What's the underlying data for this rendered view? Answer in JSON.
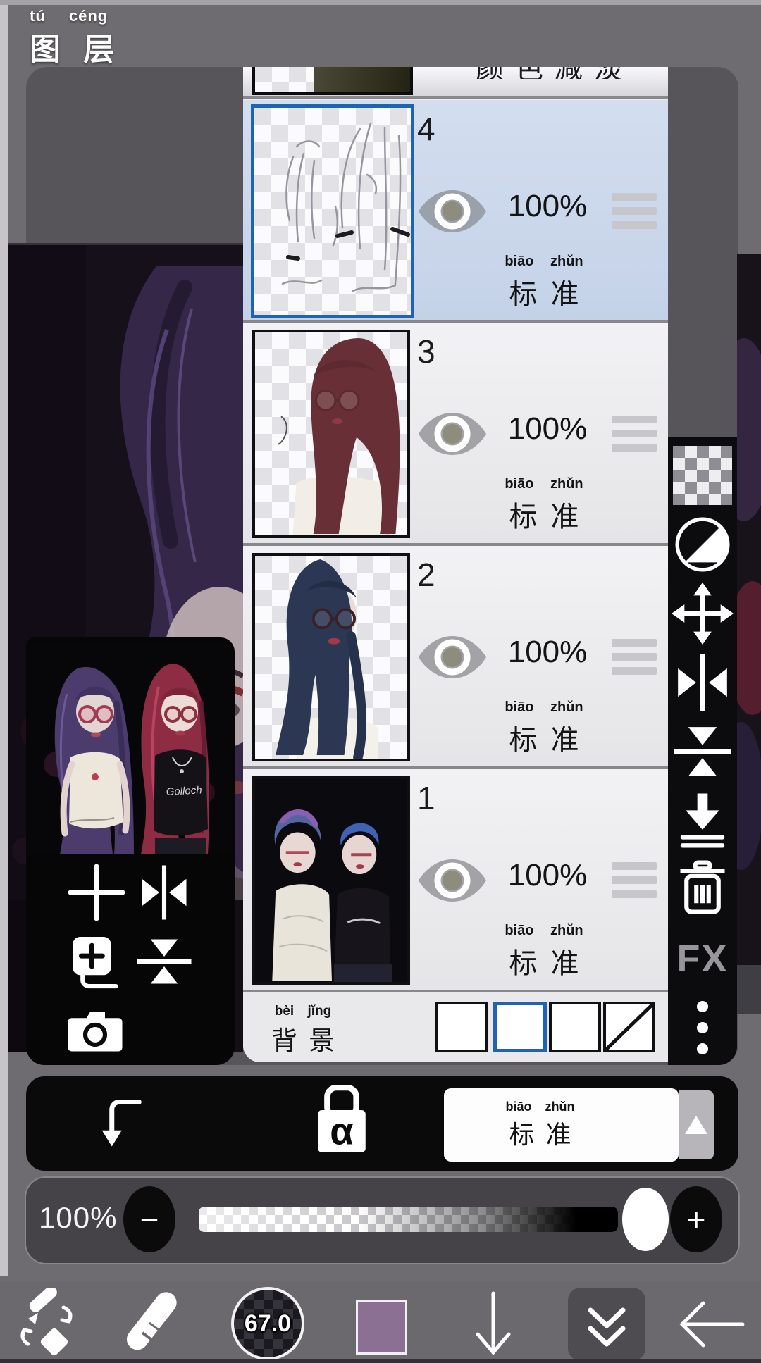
{
  "app": {
    "title_zh": "图 层",
    "title_pinyin": "tú céng"
  },
  "colors": {
    "accent_blue": "#1f63b2",
    "selected_row_bg": "#ccd8ec",
    "panel_bg": "#eceaee",
    "swatch_color": "#8c7094"
  },
  "layers_panel": {
    "partial_row_blend_zh": "颜色减淡",
    "rows": [
      {
        "number": "4",
        "opacity": "100%",
        "blend_zh": "标 准",
        "blend_pinyin": "biāo zhǔn",
        "selected": true,
        "visible": true
      },
      {
        "number": "3",
        "opacity": "100%",
        "blend_zh": "标 准",
        "blend_pinyin": "biāo zhǔn",
        "selected": false,
        "visible": true
      },
      {
        "number": "2",
        "opacity": "100%",
        "blend_zh": "标 准",
        "blend_pinyin": "biāo zhǔn",
        "selected": false,
        "visible": true
      },
      {
        "number": "1",
        "opacity": "100%",
        "blend_zh": "标 准",
        "blend_pinyin": "biāo zhǔn",
        "selected": false,
        "visible": true
      }
    ],
    "background_row": {
      "label_zh": "背 景",
      "label_pinyin": "bèi jǐng",
      "options": [
        "white",
        "transparent",
        "dark-checker",
        "hidden"
      ],
      "selected_option": "transparent"
    }
  },
  "right_toolbar": {
    "fx_label": "FX",
    "items": [
      "transparency-background",
      "tone-half-circle",
      "move-layer",
      "flip-horizontal",
      "flip-vertical",
      "merge-down",
      "delete-layer",
      "fx-effects",
      "more-options"
    ]
  },
  "left_panel": {
    "shirt_text": "Golloch",
    "items": [
      "add-layer",
      "flip-horizontal",
      "duplicate-layer",
      "flip-vertical",
      "camera-import"
    ]
  },
  "blend_bar": {
    "alpha_label": "α",
    "blend_zh": "标 准",
    "blend_pinyin": "biāo zhǔn"
  },
  "zoom_bar": {
    "value": "100%",
    "minus": "−",
    "plus": "+"
  },
  "bottom_toolbar": {
    "brush_size": "67.0",
    "color": "#8c7094"
  }
}
